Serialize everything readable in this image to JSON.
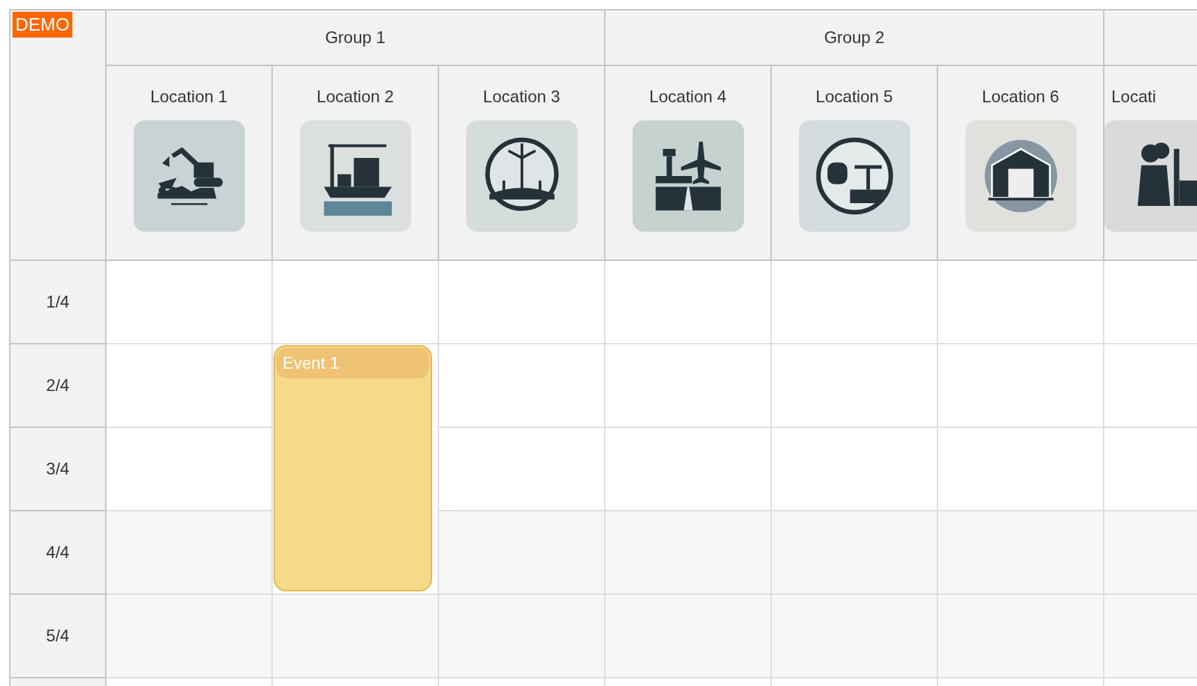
{
  "badge": "DEMO",
  "groups": [
    {
      "label": "Group 1",
      "locations": [
        {
          "name": "Location 1",
          "kind": "excavator"
        },
        {
          "name": "Location 2",
          "kind": "ship",
          "schedule": [
            {
              "kind": "free"
            },
            {
              "kind": "start",
              "title": "Event 1"
            },
            {
              "kind": "continue"
            },
            {
              "kind": "end"
            },
            {
              "kind": "free"
            }
          ]
        },
        {
          "name": "Location 3",
          "kind": "wind"
        }
      ]
    },
    {
      "label": "Group 2",
      "locations": [
        {
          "name": "Location 4",
          "kind": "airport"
        },
        {
          "name": "Location 5",
          "kind": "train"
        },
        {
          "name": "Location 6",
          "kind": "warehouse"
        }
      ]
    },
    {
      "locations": [
        {
          "name": "Locati",
          "kind": "plant"
        }
      ]
    }
  ],
  "rows": [
    {
      "label": "1/4",
      "kind": "plain"
    },
    {
      "label": "2/4",
      "kind": "plain"
    },
    {
      "label": "3/4",
      "kind": "plain"
    },
    {
      "label": "4/4",
      "kind": "shaded"
    },
    {
      "label": "5/4",
      "kind": "shaded"
    },
    {
      "kind": "plain"
    }
  ]
}
